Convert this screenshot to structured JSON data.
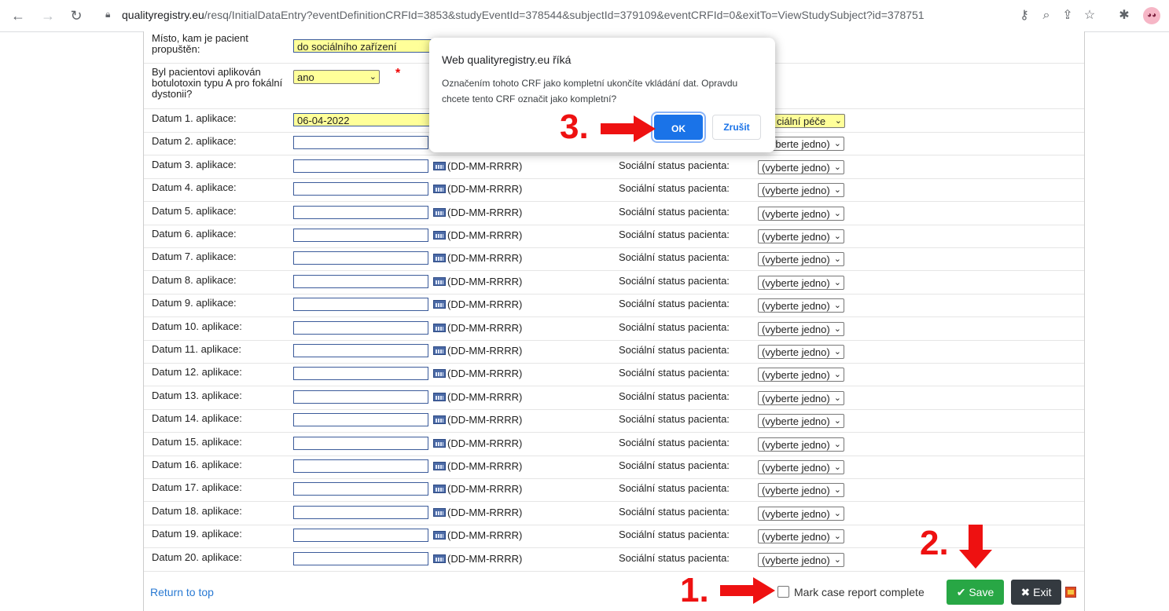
{
  "browser": {
    "url_host": "qualityregistry.eu",
    "url_path": "/resq/InitialDataEntry?eventDefinitionCRFId=3853&studyEventId=378544&subjectId=379109&eventCRFId=0&exitTo=ViewStudySubject?id=378751"
  },
  "form": {
    "discharge_label": "Místo, kam je pacient propuštěn:",
    "discharge_value": "do sociálního zařízení",
    "botox_label": "Byl pacientovi aplikován botulotoxin typu A pro fokální dystonii?",
    "botox_value": "ano",
    "required_mark": "*",
    "first_social_value": "ciální péče",
    "rows": [
      {
        "label": "Datum 1. aplikace:",
        "date": "06-04-2022"
      },
      {
        "label": "Datum 2. aplikace:"
      },
      {
        "label": "Datum 3. aplikace:"
      },
      {
        "label": "Datum 4. aplikace:"
      },
      {
        "label": "Datum 5. aplikace:"
      },
      {
        "label": "Datum 6. aplikace:"
      },
      {
        "label": "Datum 7. aplikace:"
      },
      {
        "label": "Datum 8. aplikace:"
      },
      {
        "label": "Datum 9. aplikace:"
      },
      {
        "label": "Datum 10. aplikace:"
      },
      {
        "label": "Datum 11. aplikace:"
      },
      {
        "label": "Datum 12. aplikace:"
      },
      {
        "label": "Datum 13. aplikace:"
      },
      {
        "label": "Datum 14. aplikace:"
      },
      {
        "label": "Datum 15. aplikace:"
      },
      {
        "label": "Datum 16. aplikace:"
      },
      {
        "label": "Datum 17. aplikace:"
      },
      {
        "label": "Datum 18. aplikace:"
      },
      {
        "label": "Datum 19. aplikace:"
      },
      {
        "label": "Datum 20. aplikace:"
      }
    ],
    "date_format": "(DD-MM-RRRR)",
    "social_label": "Sociální status pacienta:",
    "social_placeholder": "(vyberte jedno)"
  },
  "footer": {
    "return_link": "Return to top",
    "mark_complete": "Mark case report complete",
    "save": "Save",
    "exit": "Exit"
  },
  "dialog": {
    "title": "Web qualityregistry.eu říká",
    "message": "Označením tohoto CRF jako kompletní ukončíte vkládání dat. Opravdu chcete tento CRF označit jako kompletní?",
    "ok": "OK",
    "cancel": "Zrušit"
  },
  "annotations": {
    "step1": "1.",
    "step2": "2.",
    "step3": "3.",
    "color": "#ee1111"
  }
}
